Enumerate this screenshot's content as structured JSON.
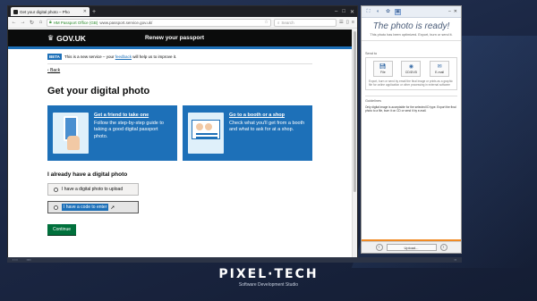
{
  "browser": {
    "tab_title": "Get your digital photo – Pho",
    "url_org": "HM Passport Office (GB)",
    "url_path": "www.passport.service.gov.uk/",
    "search_placeholder": "Search"
  },
  "govuk": {
    "logo_text": "GOV.UK",
    "service_name": "Renew your passport",
    "beta_tag": "BETA",
    "beta_text_pre": "This is a new service – your ",
    "beta_link": "feedback",
    "beta_text_post": " will help us to improve it.",
    "back_link": "Back",
    "page_title": "Get your digital photo",
    "cards": [
      {
        "link": "Get a friend to take one",
        "text": "Follow the step-by-step guide to taking a good digital passport photo."
      },
      {
        "link": "Go to a booth or a shop",
        "text": "Check what you'll get from a booth and what to ask for at a shop."
      }
    ],
    "subtitle": "I already have a digital photo",
    "options": [
      {
        "label": "I have a digital photo to upload"
      },
      {
        "label": "I have a code to enter"
      }
    ],
    "continue_label": "Continue"
  },
  "app": {
    "title": "The photo is ready!",
    "subtitle": "This photo has been optimized. Export, burn or send it.",
    "send_label": "Send to",
    "send_buttons": [
      {
        "label": "File",
        "icon": "save-icon"
      },
      {
        "label": "CD/DVD",
        "icon": "disc-icon"
      },
      {
        "label": "E-mail",
        "icon": "mail-icon"
      }
    ],
    "send_note": "Export, burn or send by email the final image or prints as a graphic file for online application or other processing in external software",
    "guidelines_label": "Guidelines",
    "guidelines_text": "Only digital image is acceptable for the selected ID type. Export the final photo to a file, burn it on CD or send it by e-mail.",
    "upload_label": "Upload..."
  },
  "brand": {
    "logo": "PIXEL·TECH",
    "subtitle": "Software Development Studio"
  },
  "accent": "#1d70b8"
}
